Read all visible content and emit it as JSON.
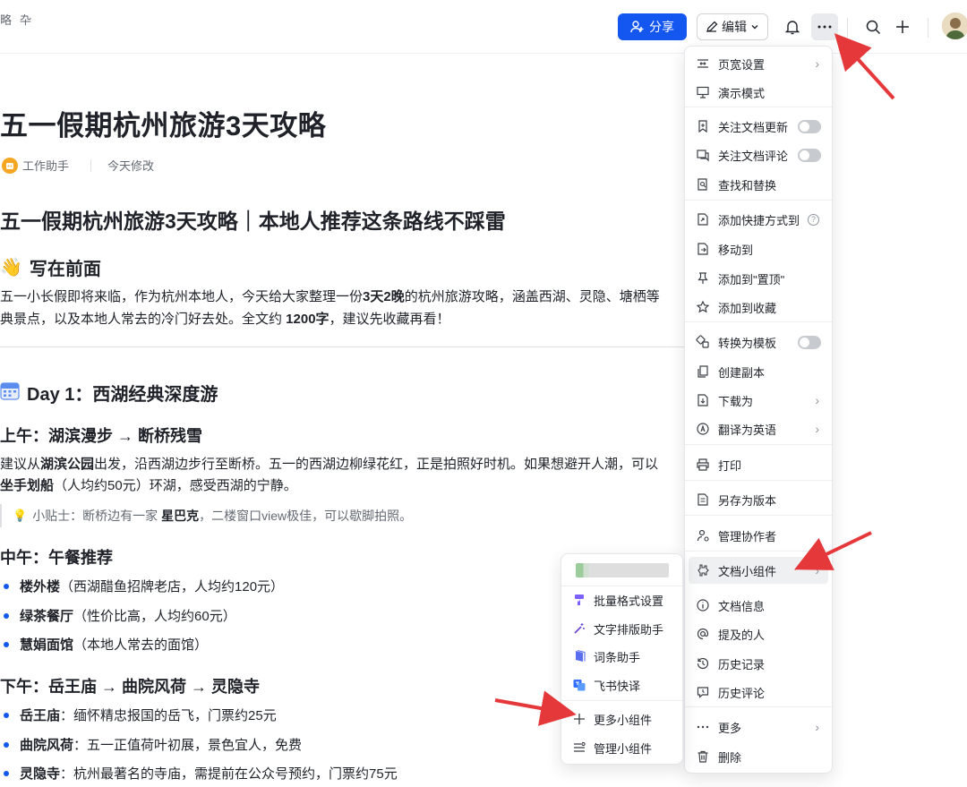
{
  "topbar": {
    "crumb_left": "略",
    "crumb_pin": "卆",
    "share_label": "分享",
    "edit_label": "编辑"
  },
  "doc": {
    "title": "五一假期杭州旅游3天攻略",
    "author": "工作助手",
    "modified": "今天修改",
    "h1": "五一假期杭州旅游3天攻略｜本地人推荐这条路线不踩雷",
    "intro_heading": "写在前面",
    "intro_line1_a": "五一小长假即将来临，作为杭州本地人，今天给大家整理一份",
    "intro_line1_b": "3天2晚",
    "intro_line1_c": "的杭州旅游攻略，涵盖西湖、灵隐、塘栖等",
    "intro_line2_a": "典景点，以及本地人常去的冷门好去处。全文约 ",
    "intro_line2_b": "1200字",
    "intro_line2_c": "，建议先收藏再看！",
    "day1_heading": "Day 1：西湖经典深度游",
    "am_heading": "上午：湖滨漫步 → 断桥残雪",
    "am_line1_a": "建议从",
    "am_line1_b": "湖滨公园",
    "am_line1_c": "出发，沿西湖边步行至断桥。五一的西湖边柳绿花红，正是拍照好时机。如果想避开人潮，可以",
    "am_line2_a": "坐手划船",
    "am_line2_b": "（人均约50元）环湖，感受西湖的宁静。",
    "tip_a": "小贴士：断桥边有一家 ",
    "tip_b": "星巴克",
    "tip_c": "，二楼窗口view极佳，可以歇脚拍照。",
    "noon_heading": "中午：午餐推荐",
    "lunch": [
      {
        "name": "楼外楼",
        "desc": "（西湖醋鱼招牌老店，人均约120元）"
      },
      {
        "name": "绿茶餐厅",
        "desc": "（性价比高，人均约60元）"
      },
      {
        "name": "慧娟面馆",
        "desc": "（本地人常去的面馆）"
      }
    ],
    "pm_heading": "下午：岳王庙 → 曲院风荷 → 灵隐寺",
    "pm": [
      {
        "name": "岳王庙",
        "desc": "：缅怀精忠报国的岳飞，门票约25元"
      },
      {
        "name": "曲院风荷",
        "desc": "：五一正值荷叶初展，景色宜人，免费"
      },
      {
        "name": "灵隐寺",
        "desc": "：杭州最著名的寺庙，需提前在公众号预约，门票约75元"
      }
    ]
  },
  "menu": {
    "items": [
      {
        "label": "页宽设置",
        "icon": "page-width-icon",
        "extra": "arrow"
      },
      {
        "label": "演示模式",
        "icon": "presentation-icon",
        "extra": ""
      },
      {
        "label": "关注文档更新",
        "icon": "bookmark-icon",
        "extra": "toggle"
      },
      {
        "label": "关注文档评论",
        "icon": "comment-follow-icon",
        "extra": "toggle"
      },
      {
        "label": "查找和替换",
        "icon": "find-replace-icon",
        "extra": ""
      },
      {
        "label": "添加快捷方式到",
        "icon": "shortcut-icon",
        "extra": "help"
      },
      {
        "label": "移动到",
        "icon": "move-icon",
        "extra": ""
      },
      {
        "label": "添加到\"置顶\"",
        "icon": "pin-icon",
        "extra": ""
      },
      {
        "label": "添加到收藏",
        "icon": "star-icon",
        "extra": ""
      },
      {
        "label": "转换为模板",
        "icon": "template-icon",
        "extra": "toggle"
      },
      {
        "label": "创建副本",
        "icon": "copy-icon",
        "extra": ""
      },
      {
        "label": "下载为",
        "icon": "download-icon",
        "extra": "arrow"
      },
      {
        "label": "翻译为英语",
        "icon": "translate-icon",
        "extra": "arrow"
      },
      {
        "label": "打印",
        "icon": "print-icon",
        "extra": ""
      },
      {
        "label": "另存为版本",
        "icon": "version-icon",
        "extra": ""
      },
      {
        "label": "管理协作者",
        "icon": "collaborator-icon",
        "extra": ""
      },
      {
        "label": "文档小组件",
        "icon": "widget-icon",
        "extra": "arrow"
      },
      {
        "label": "文档信息",
        "icon": "info-icon",
        "extra": ""
      },
      {
        "label": "提及的人",
        "icon": "at-icon",
        "extra": ""
      },
      {
        "label": "历史记录",
        "icon": "history-icon",
        "extra": ""
      },
      {
        "label": "历史评论",
        "icon": "history-comment-icon",
        "extra": ""
      },
      {
        "label": "更多",
        "icon": "more-icon",
        "extra": "arrow"
      },
      {
        "label": "删除",
        "icon": "trash-icon",
        "extra": ""
      }
    ]
  },
  "submenu": {
    "items": [
      {
        "label": "批量格式设置",
        "icon": "format-brush-icon"
      },
      {
        "label": "文字排版助手",
        "icon": "magic-wand-icon"
      },
      {
        "label": "词条助手",
        "icon": "entry-icon"
      },
      {
        "label": "飞书快译",
        "icon": "quick-translate-icon"
      },
      {
        "label": "更多小组件",
        "icon": "plus-icon"
      },
      {
        "label": "管理小组件",
        "icon": "manage-icon"
      }
    ]
  },
  "colors": {
    "accent": "#1456f0",
    "annotation_arrow": "#e5383b"
  }
}
